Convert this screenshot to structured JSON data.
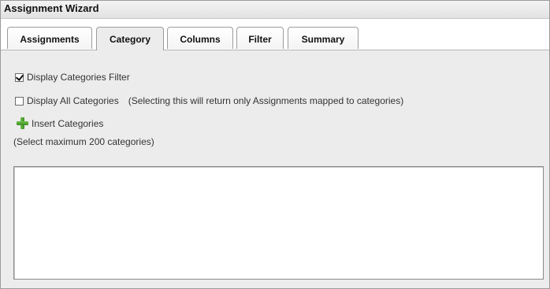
{
  "window": {
    "title": "Assignment Wizard"
  },
  "tabs": [
    {
      "label": "Assignments",
      "active": false
    },
    {
      "label": "Category",
      "active": true
    },
    {
      "label": "Columns",
      "active": false
    },
    {
      "label": "Filter",
      "active": false
    },
    {
      "label": "Summary",
      "active": false
    }
  ],
  "category": {
    "display_filter": {
      "label": "Display Categories Filter",
      "checked": true
    },
    "display_all": {
      "label": "Display All Categories",
      "checked": false,
      "note": "(Selecting this will return only Assignments mapped to categories)"
    },
    "insert_label": "Insert Categories",
    "insert_icon": "plus-icon",
    "max_note": "(Select maximum 200 categories)"
  },
  "colors": {
    "panel_bg": "#ececec",
    "plus_icon": "#4a9a2e"
  }
}
